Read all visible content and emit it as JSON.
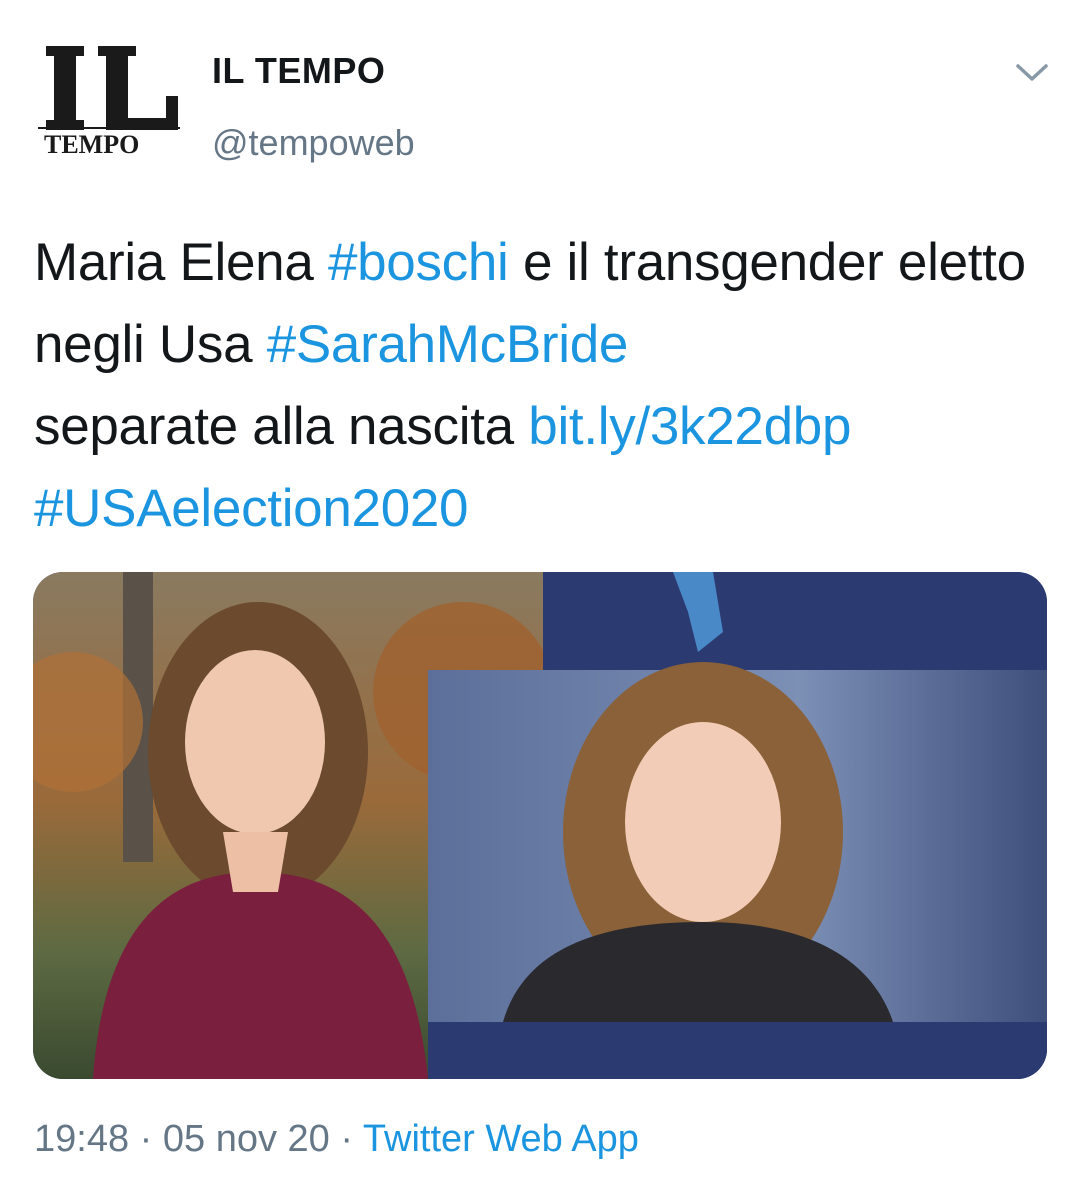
{
  "header": {
    "display_name": "IL TEMPO",
    "handle": "@tempoweb",
    "avatar": {
      "logo_top": "IL",
      "logo_bottom": "TEMPO"
    },
    "menu_icon": "chevron-down-icon"
  },
  "tweet": {
    "segments": [
      {
        "text": "Maria Elena ",
        "type": "text"
      },
      {
        "text": "#boschi",
        "type": "hashtag"
      },
      {
        "text": " e il transgender eletto negli Usa ",
        "type": "text"
      },
      {
        "text": "#SarahMcBride",
        "type": "hashtag"
      },
      {
        "text": " separate alla nascita ",
        "type": "text"
      },
      {
        "text": "bit.ly/3k22dbp",
        "type": "link"
      },
      {
        "text": " ",
        "type": "text"
      },
      {
        "text": "#USAelection2020",
        "type": "hashtag"
      }
    ]
  },
  "meta": {
    "time": "19:48",
    "separator": "·",
    "date": "05 nov 20",
    "source": "Twitter Web App"
  },
  "colors": {
    "link": "#1b95e0",
    "secondary_text": "#657786",
    "primary_text": "#14171a",
    "media_navy": "#2b3a70"
  }
}
